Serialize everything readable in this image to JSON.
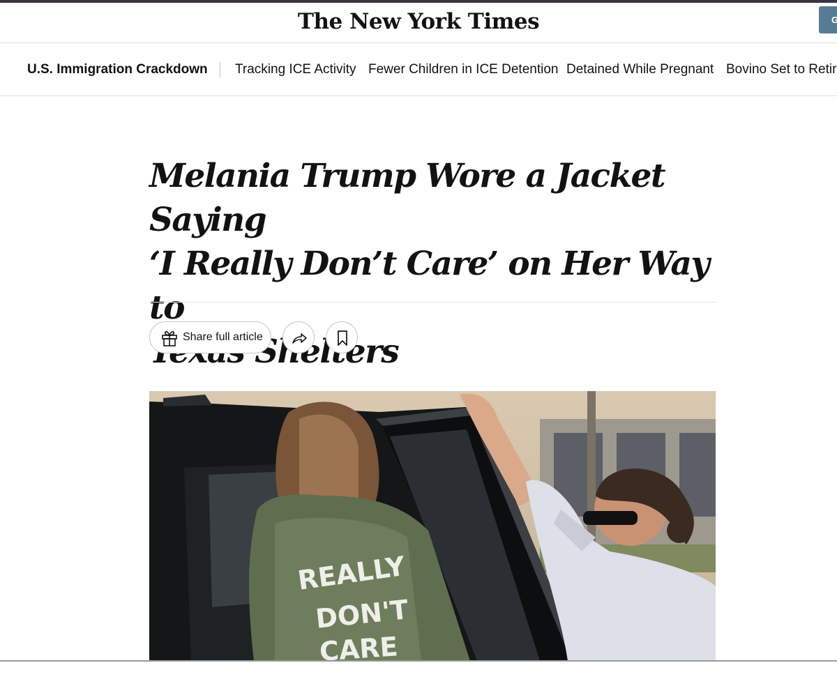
{
  "masthead": {
    "logo": "The New York Times",
    "button_label": "G"
  },
  "subnav": {
    "title": "U.S. Immigration Crackdown",
    "links": [
      "Tracking ICE Activity",
      "Fewer Children in ICE Detention",
      "Detained While Pregnant",
      "Bovino Set to Retire"
    ]
  },
  "article": {
    "headline_lines": [
      "Melania Trump Wore a Jacket Saying",
      "‘I Really Don’t Care’ on Her Way to",
      "Texas Shelters"
    ],
    "share_label": "Share full article",
    "icons": {
      "gift": "gift-icon",
      "share": "share-arrow-icon",
      "bookmark": "bookmark-icon"
    }
  },
  "photo": {
    "jacket_text": [
      "REALLY",
      "DON'T",
      "CARE"
    ]
  },
  "colors": {
    "text": "#121212",
    "header_button": "#567b95",
    "divider": "#dfdfdf"
  }
}
